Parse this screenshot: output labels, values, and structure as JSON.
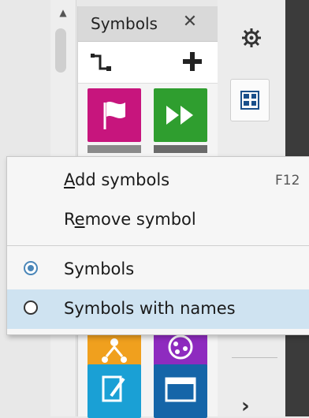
{
  "panel": {
    "title": "Symbols",
    "close_glyph": "✕"
  },
  "tiles": [
    {
      "icon": "flag-icon",
      "color": "#c7157d"
    },
    {
      "icon": "fast-forward-icon",
      "color": "#2f9e2f"
    },
    {
      "icon": "org-chart-icon",
      "color": "#f0a01e"
    },
    {
      "icon": "share-icon",
      "color": "#8e2bbf"
    },
    {
      "icon": "edit-document-icon",
      "color": "#1aa0d5"
    },
    {
      "icon": "window-icon",
      "color": "#1565a8"
    }
  ],
  "context_menu": {
    "add_symbols": {
      "label": "Add symbols",
      "accel": "A",
      "shortcut": "F12"
    },
    "remove_symbol": {
      "label": "Remove symbol",
      "accel": "e"
    },
    "view_symbols": {
      "label": "Symbols",
      "checked": true
    },
    "view_symbols_with_names": {
      "label": "Symbols with names",
      "checked": false
    }
  },
  "right_bar": {
    "chevron": "›"
  },
  "colors": {
    "menu_highlight": "#cfe3f1",
    "radio_accent": "#4a86b8"
  }
}
